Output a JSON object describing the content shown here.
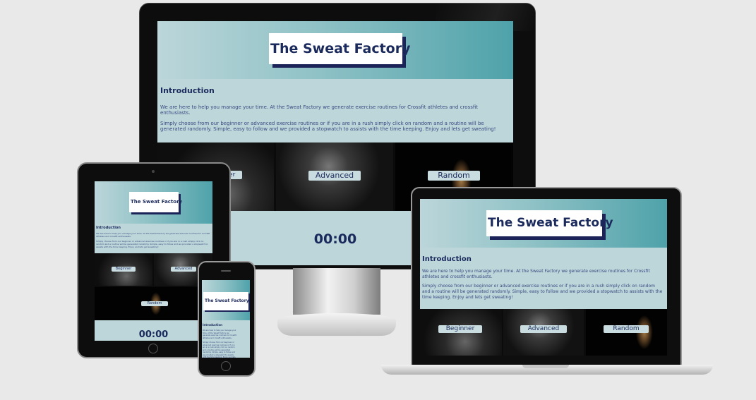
{
  "site": {
    "title": "The Sweat Factory",
    "intro_heading": "Introduction",
    "intro_p1": "We are here to help you manage your time. At the Sweat Factory we generate exercise routines for Crossfit athletes and crossfit enthusiasts.",
    "intro_p2": "Simply choose from our beginner or advanced exercise routines or if you are in a rush simply click on random and a routine will be generated randomly. Simple, easy to follow and we provided a stopwatch to assists with the time keeping. Enjoy and lets get sweating!",
    "btn_beginner": "Beginner",
    "btn_advanced": "Advanced",
    "btn_random": "Random",
    "timer": "00:00"
  },
  "colors": {
    "navy": "#1b2a5c",
    "teal": "#4fa2aa",
    "pale": "#bcd6da",
    "bezel": "#111111",
    "background": "#e9e9e9"
  },
  "devices": [
    "desktop-monitor",
    "tablet",
    "phone",
    "laptop"
  ]
}
